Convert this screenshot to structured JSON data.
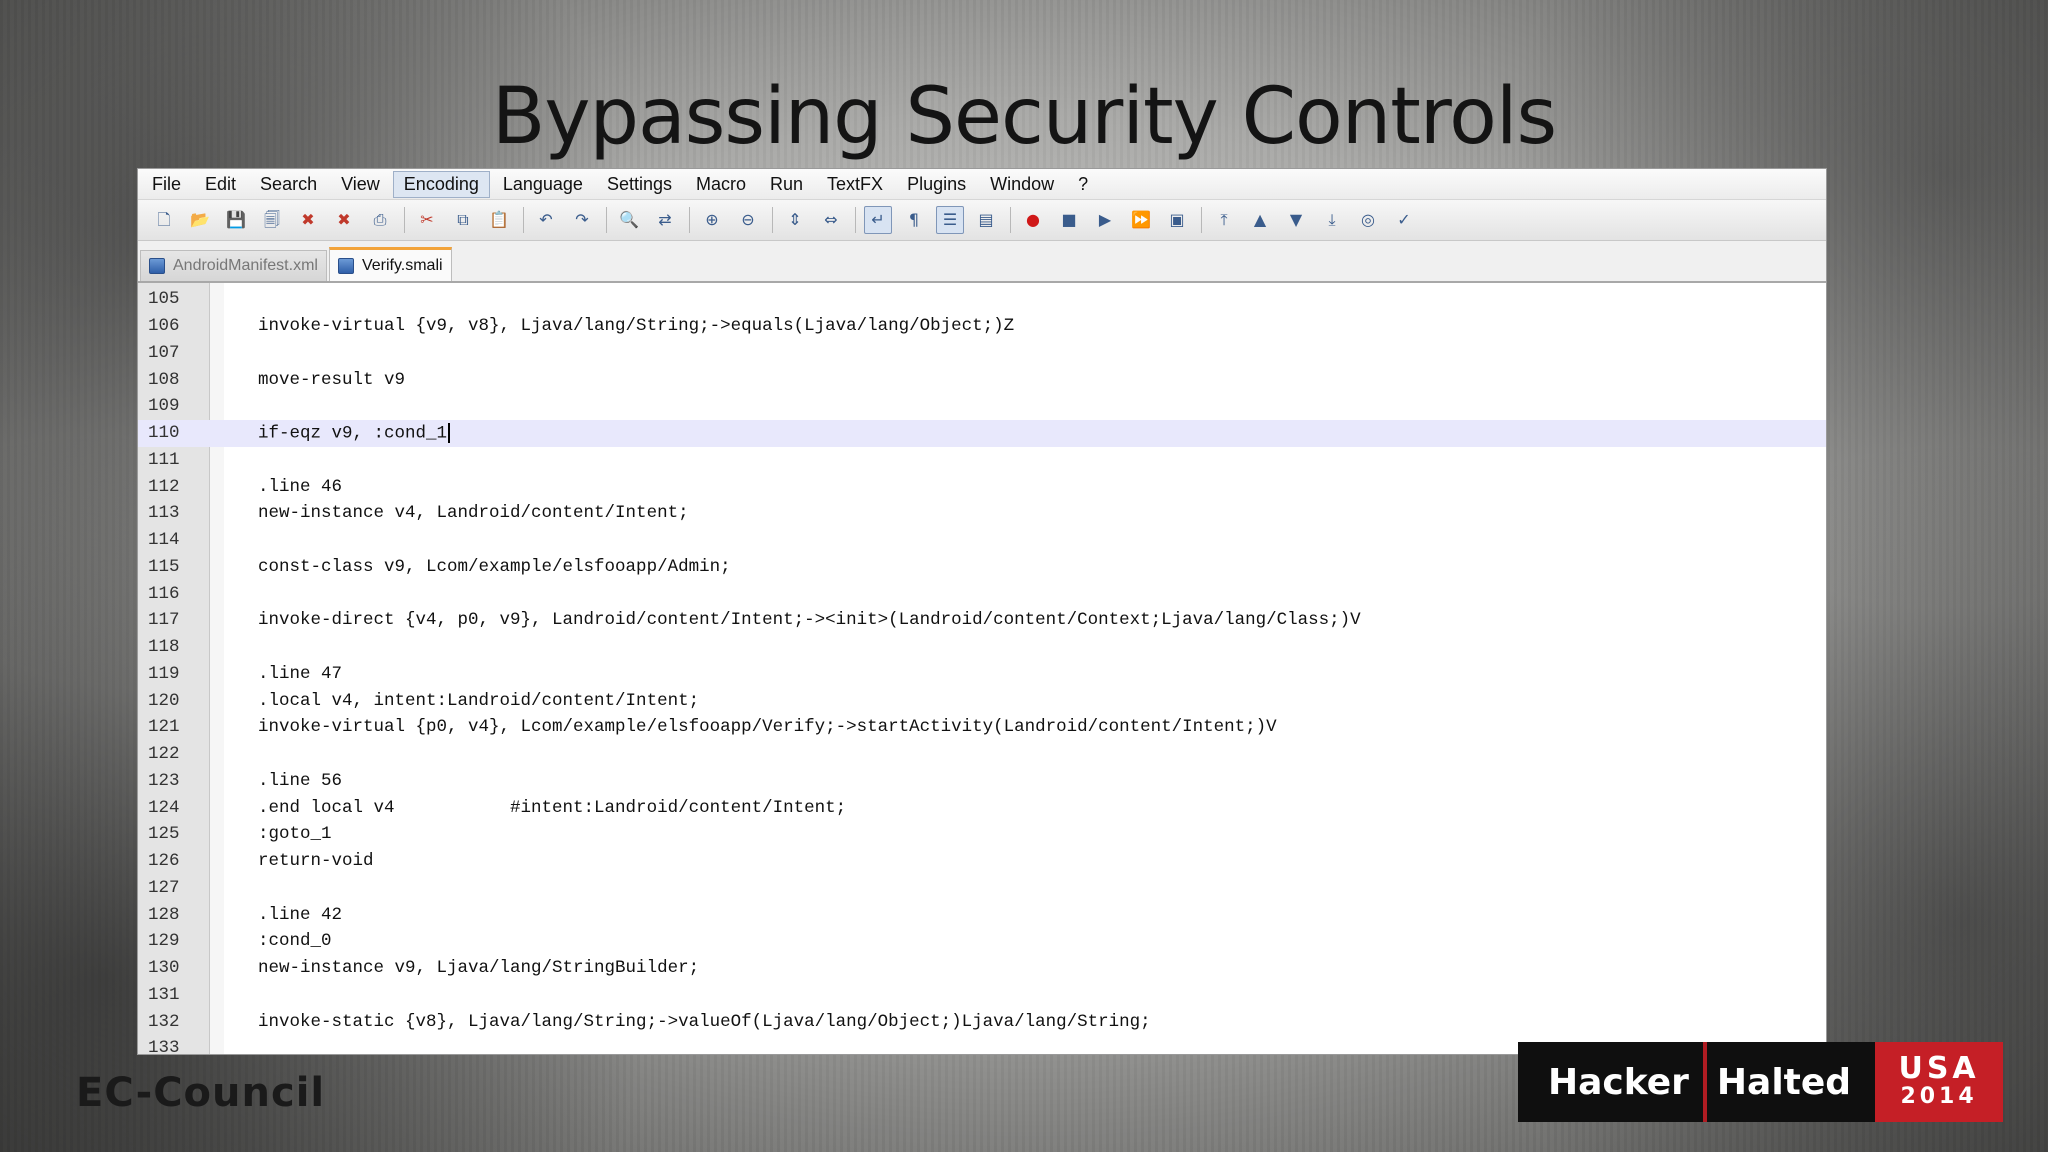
{
  "slide": {
    "title": "Bypassing Security Controls",
    "footer_logo": "EC-Council",
    "badge": {
      "word1": "Hacker",
      "word2": "Halted",
      "country": "USA",
      "year": "2014"
    }
  },
  "menubar": {
    "items": [
      "File",
      "Edit",
      "Search",
      "View",
      "Encoding",
      "Language",
      "Settings",
      "Macro",
      "Run",
      "TextFX",
      "Plugins",
      "Window",
      "?"
    ],
    "active": "Encoding"
  },
  "toolbar": {
    "icons": [
      "new-file-icon",
      "open-file-icon",
      "save-icon",
      "save-all-icon",
      "close-icon",
      "close-all-icon",
      "print-icon",
      "cut-icon",
      "copy-icon",
      "paste-icon",
      "undo-icon",
      "redo-icon",
      "find-icon",
      "replace-icon",
      "zoom-in-icon",
      "zoom-out-icon",
      "sync-vertical-icon",
      "sync-horizontal-icon",
      "word-wrap-icon",
      "show-all-chars-icon",
      "indent-guide-icon",
      "document-map-icon",
      "record-macro-icon",
      "stop-macro-icon",
      "play-macro-icon",
      "run-macro-multiple-icon",
      "save-macro-icon",
      "jump-top-icon",
      "previous-icon",
      "next-icon",
      "jump-bottom-icon",
      "launch-icon",
      "spellcheck-icon"
    ]
  },
  "tabs": [
    {
      "label": "AndroidManifest.xml",
      "active": false
    },
    {
      "label": "Verify.smali",
      "active": true
    }
  ],
  "editor": {
    "current_line": "110",
    "lines": [
      {
        "n": "105",
        "code": ""
      },
      {
        "n": "106",
        "code": "invoke-virtual {v9, v8}, Ljava/lang/String;->equals(Ljava/lang/Object;)Z"
      },
      {
        "n": "107",
        "code": ""
      },
      {
        "n": "108",
        "code": "move-result v9"
      },
      {
        "n": "109",
        "code": ""
      },
      {
        "n": "110",
        "code": "if-eqz v9, :cond_1"
      },
      {
        "n": "111",
        "code": ""
      },
      {
        "n": "112",
        "code": ".line 46"
      },
      {
        "n": "113",
        "code": "new-instance v4, Landroid/content/Intent;"
      },
      {
        "n": "114",
        "code": ""
      },
      {
        "n": "115",
        "code": "const-class v9, Lcom/example/elsfooapp/Admin;"
      },
      {
        "n": "116",
        "code": ""
      },
      {
        "n": "117",
        "code": "invoke-direct {v4, p0, v9}, Landroid/content/Intent;-><init>(Landroid/content/Context;Ljava/lang/Class;)V"
      },
      {
        "n": "118",
        "code": ""
      },
      {
        "n": "119",
        "code": ".line 47"
      },
      {
        "n": "120",
        "code": ".local v4, intent:Landroid/content/Intent;"
      },
      {
        "n": "121",
        "code": "invoke-virtual {p0, v4}, Lcom/example/elsfooapp/Verify;->startActivity(Landroid/content/Intent;)V"
      },
      {
        "n": "122",
        "code": ""
      },
      {
        "n": "123",
        "code": ".line 56"
      },
      {
        "n": "124",
        "code": ".end local v4           #intent:Landroid/content/Intent;"
      },
      {
        "n": "125",
        "code": ":goto_1"
      },
      {
        "n": "126",
        "code": "return-void"
      },
      {
        "n": "127",
        "code": ""
      },
      {
        "n": "128",
        "code": ".line 42"
      },
      {
        "n": "129",
        "code": ":cond_0"
      },
      {
        "n": "130",
        "code": "new-instance v9, Ljava/lang/StringBuilder;"
      },
      {
        "n": "131",
        "code": ""
      },
      {
        "n": "132",
        "code": "invoke-static {v8}, Ljava/lang/String;->valueOf(Ljava/lang/Object;)Ljava/lang/String;"
      },
      {
        "n": "133",
        "code": ""
      }
    ]
  }
}
